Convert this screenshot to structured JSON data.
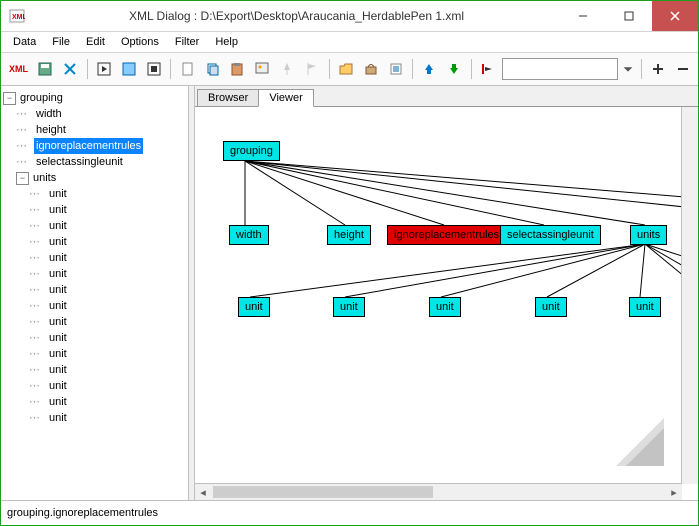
{
  "window": {
    "title": "XML Dialog : D:\\Export\\Desktop\\Araucania_HerdablePen 1.xml"
  },
  "menu": {
    "data": "Data",
    "file": "File",
    "edit": "Edit",
    "options": "Options",
    "filter": "Filter",
    "help": "Help"
  },
  "toolbar": {
    "xml_label": "XML"
  },
  "tree": {
    "root": "grouping",
    "root_children": [
      "width",
      "height",
      "ignoreplacementrules",
      "selectassingleunit"
    ],
    "selected": "ignoreplacementrules",
    "units_label": "units",
    "unit_label": "unit",
    "unit_count": 15
  },
  "tabs": {
    "browser": "Browser",
    "viewer": "Viewer"
  },
  "graph": {
    "grouping": "grouping",
    "width": "width",
    "height": "height",
    "ignore": "ignoreplacementrules",
    "select": "selectassingleunit",
    "units": "units",
    "unit": "unit"
  },
  "status": {
    "path": "grouping.ignoreplacementrules"
  }
}
